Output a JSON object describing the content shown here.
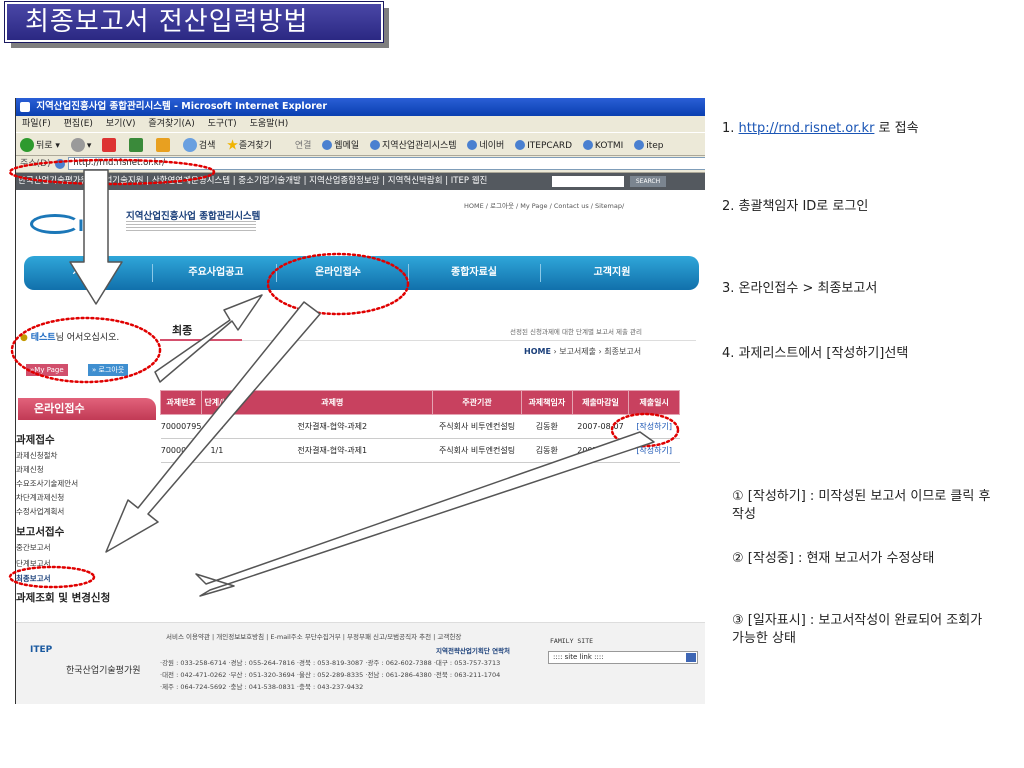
{
  "slide": {
    "title": "최종보고서 전산입력방법"
  },
  "browser": {
    "window_title": "지역산업진흥사업 종합관리시스템 - Microsoft Internet Explorer",
    "menu": [
      "파일(F)",
      "편집(E)",
      "보기(V)",
      "즐겨찾기(A)",
      "도구(T)",
      "도움말(H)"
    ],
    "toolbar": {
      "back": "뒤로",
      "search": "검색",
      "favorites": "즐겨찾기",
      "links_label": "연결",
      "links": [
        "웹메일",
        "지역산업관리시스템",
        "네이버",
        "ITEPCARD",
        "KOTMI",
        "itep"
      ]
    },
    "address_label": "주소(D)",
    "address_value": "http://rnd.risnet.or.kr/"
  },
  "site": {
    "topnav": "한국산업기술평가원 | 산업기술지원 | 산학연연계운영시스템 | 중소기업기술개발 | 지역산업종합정보망 | 지역혁신박람회 | ITEP 웹진",
    "search_btn": "SEARCH",
    "util_links": "HOME  /  로그아웃  /  My Page  /  Contact us  /  Sitemap/",
    "logo_text": "IIP",
    "system_name": "지역산업진흥사업 종합관리시스템",
    "mainnav": [
      "사업",
      "주요사업공고",
      "온라인접수",
      "종합자료실",
      "고객지원"
    ],
    "welcome": {
      "user": "테스트",
      "suffix": "님 어서오십시오."
    },
    "mypage_btn": "»My Page",
    "logout_btn": "» 로그아웃",
    "lnb_title": "온라인접수",
    "lnb": {
      "section1": "과제접수",
      "section1_items": [
        "과제신청절차",
        "과제신청",
        "수요조사기술제안서",
        "차단계과제신청",
        "수정사업계획서"
      ],
      "section2": "보고서접수",
      "section2_items": [
        "중간보고서",
        "단계보고서",
        "최종보고서"
      ],
      "section3": "과제조회 및 변경신청"
    },
    "page_heading": "최종",
    "desc_text": "선정된 신청과제에 대한 단계별 보고서 제출 관리",
    "breadcrumb": {
      "home": "HOME",
      "rest": " › 보고서제출 › 최종보고서"
    },
    "table": {
      "headers": [
        "과제번호",
        "단계/년",
        "과제명",
        "주관기관",
        "과제책임자",
        "제출마감일",
        "제출일시"
      ],
      "rows": [
        [
          "70000795",
          "1/1",
          "전자결재-협약-과제2",
          "주식회사 비투엔컨설팅",
          "김동환",
          "2007-08-07",
          "[작성하기]"
        ],
        [
          "70000794",
          "1/1",
          "전자결재-협약-과제1",
          "주식회사 비투엔컨설팅",
          "김동환",
          "2007-08-07",
          "[작성하기]"
        ]
      ]
    },
    "footer": {
      "links": "서비스 이용약관  |  개인정보보호방침  |  E-mail주소 무단수집거부  |  부정부패 신고/모범공직자 추천  |  고객헌장",
      "logo": "ITEP",
      "org": "한국산업기술평가원",
      "contact_title": "지역전략산업기획단 연락처",
      "contact_lines": [
        "·강원 : 033-258-6714  ·경남 : 055-264-7816  ·경북 : 053-819-3087  ·광주 : 062-602-7388  ·대구 : 053-757-3713",
        "·대전 : 042-471-0262  ·부산 : 051-320-3694  ·울산 : 052-289-8335  ·전남 : 061-286-4380  ·전북 : 063-211-1704",
        "·제주 : 064-724-5692  ·충남 : 041-538-0831  ·충북 : 043-237-9432"
      ],
      "family_site": "FAMILY SITE",
      "site_link": ":::: site link ::::"
    }
  },
  "steps": {
    "step1_prefix": "1. ",
    "step1_link": "http://rnd.risnet.or.kr",
    "step1_suffix": " 로 접속",
    "step2": "2. 총괄책임자 ID로 로그인",
    "step3": "3. 온라인접수 > 최종보고서",
    "step4": "4. 과제리스트에서 [작성하기]선택"
  },
  "notes": {
    "note1": "① [작성하기] : 미작성된 보고서 이므로 클릭 후 작성",
    "note2": "② [작성중] : 현재 보고서가 수정상태",
    "note3": "③ [일자표시] : 보고서작성이 완료되어 조회가 가능한 상태"
  },
  "colors": {
    "title_bg": "#2b2883",
    "accent_red": "#e00000",
    "nav_blue": "#1170ab",
    "table_header": "#c8415f"
  }
}
